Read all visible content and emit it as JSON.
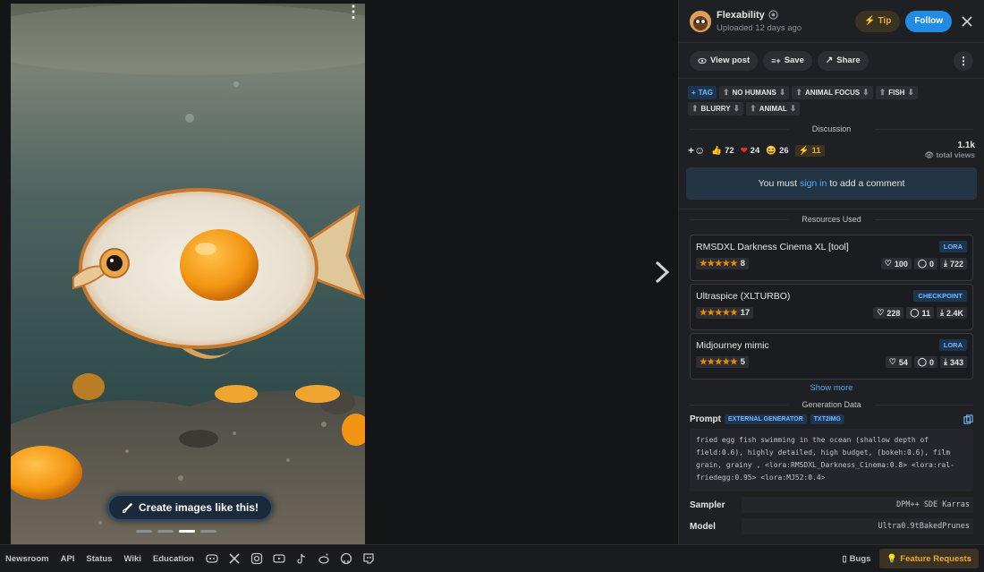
{
  "viewer": {
    "create_label": "Create images like this!",
    "dots": [
      false,
      false,
      true,
      false
    ]
  },
  "author": {
    "name": "Flexability",
    "uploaded": "Uploaded 12 days ago",
    "tip_label": "Tip",
    "follow_label": "Follow"
  },
  "actions": {
    "view_post": "View post",
    "save": "Save",
    "share": "Share"
  },
  "tags": {
    "add_label": "TAG",
    "items": [
      "NO HUMANS",
      "ANIMAL FOCUS",
      "FISH",
      "BLURRY",
      "ANIMAL"
    ]
  },
  "discussion": {
    "title": "Discussion",
    "likes": "72",
    "hearts": "24",
    "laughs": "26",
    "boosts": "11",
    "views_count": "1.1k",
    "views_label": "total views",
    "signin_prefix": "You must",
    "signin_link": "sign in",
    "signin_suffix": "to add a comment"
  },
  "resources": {
    "title": "Resources Used",
    "items": [
      {
        "name": "RMSDXL Darkness Cinema XL [tool]",
        "type": "LORA",
        "rating": 5,
        "rating_count": "8",
        "likes": "100",
        "comments": "0",
        "downloads": "722"
      },
      {
        "name": "Ultraspice (XLTURBO)",
        "type": "CHECKPOINT",
        "rating": 5,
        "rating_count": "17",
        "likes": "228",
        "comments": "11",
        "downloads": "2.4K"
      },
      {
        "name": "Midjourney mimic",
        "type": "LORA",
        "rating": 5,
        "rating_count": "5",
        "likes": "54",
        "comments": "0",
        "downloads": "343"
      }
    ],
    "show_more": "Show more"
  },
  "generation": {
    "title": "Generation Data",
    "prompt_label": "Prompt",
    "badge1": "EXTERNAL GENERATOR",
    "badge2": "TXT2IMG",
    "prompt": "fried egg fish swimming in the ocean (shallow depth of field:0.6), highly detailed, high budget, (bokeh:0.6), film grain, grainy , <lora:RMSDXL_Darkness_Cinema:0.8> <lora:ral-friedegg:0.95> <lora:MJ52:0.4>",
    "sampler_label": "Sampler",
    "sampler": "DPM++ SDE Karras",
    "model_label": "Model",
    "model": "Ultra0.9tBakedPrunes"
  },
  "footer": {
    "links": [
      "Newsroom",
      "API",
      "Status",
      "Wiki",
      "Education"
    ],
    "icons": [
      "discord-icon",
      "x-icon",
      "instagram-icon",
      "youtube-icon",
      "tiktok-icon",
      "reddit-icon",
      "github-icon",
      "twitch-icon"
    ],
    "bugs": "Bugs",
    "feature": "Feature Requests"
  }
}
